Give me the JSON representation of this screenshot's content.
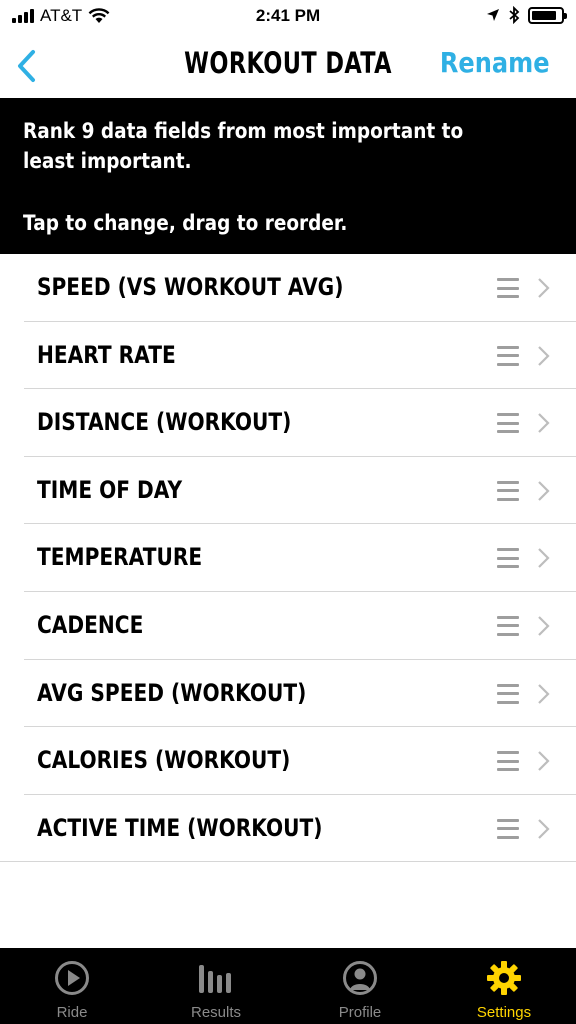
{
  "status_bar": {
    "carrier": "AT&T",
    "time": "2:41 PM",
    "battery_level": 0.85
  },
  "nav": {
    "title": "WORKOUT DATA",
    "back_icon": "chevron-left-icon",
    "rename_label": "Rename"
  },
  "banner": {
    "line1": "Rank 9 data fields from most important to",
    "line2": "least important.",
    "line3": "Tap to change, drag to reorder."
  },
  "fields": [
    {
      "label": "SPEED (VS WORKOUT AVG)"
    },
    {
      "label": "HEART RATE"
    },
    {
      "label": "DISTANCE (WORKOUT)"
    },
    {
      "label": "TIME OF DAY"
    },
    {
      "label": "TEMPERATURE"
    },
    {
      "label": "CADENCE"
    },
    {
      "label": "AVG SPEED (WORKOUT)"
    },
    {
      "label": "CALORIES (WORKOUT)"
    },
    {
      "label": "ACTIVE TIME (WORKOUT)"
    }
  ],
  "tabs": [
    {
      "label": "Ride",
      "icon": "play-circle-icon",
      "active": false
    },
    {
      "label": "Results",
      "icon": "bar-chart-icon",
      "active": false
    },
    {
      "label": "Profile",
      "icon": "profile-icon",
      "active": false
    },
    {
      "label": "Settings",
      "icon": "gear-icon",
      "active": true
    }
  ],
  "colors": {
    "accent_blue": "#2fb0e4",
    "active_tab": "#ffd400",
    "inactive_tab": "#8a8a8a"
  }
}
